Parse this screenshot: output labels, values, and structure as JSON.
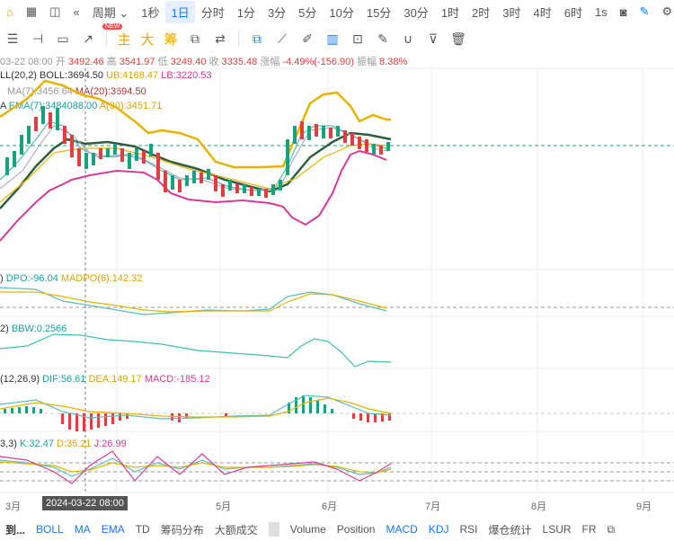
{
  "toolbar": {
    "period_label": "周期",
    "intervals": [
      "1秒",
      "1日",
      "分时",
      "1分",
      "3分",
      "5分",
      "10分",
      "15分",
      "30分",
      "1时",
      "2时",
      "3时",
      "4时",
      "6时"
    ],
    "active_interval": "1日",
    "right_interval": "1s",
    "new_badge": "NEW"
  },
  "toolbar2": {
    "main": "主",
    "big": "大",
    "chip": "筹"
  },
  "ohlc": {
    "date": "03-22 08:00",
    "open_label": "开",
    "open": "3492.46",
    "high_label": "高",
    "high": "3541.97",
    "low_label": "低",
    "low": "3249.40",
    "close_label": "收",
    "close": "3335.48",
    "change_label": "涨幅",
    "change": "-4.49%(-156.90)",
    "amp_label": "振幅",
    "amp": "8.38%"
  },
  "boll": {
    "name": "LL(20,2)",
    "boll": "BOLL:3694.50",
    "ub": "UB:4168.47",
    "lb": "LB:3220.53"
  },
  "ma": {
    "ma7": "MA(7):3456.64",
    "ma20": "MA(20):3694.50"
  },
  "ema": {
    "prefix": "A",
    "ema7": "EMA(7):3484088.00",
    "ema30": "A(30):3451.71"
  },
  "dpo": {
    "dpo": "DPO:-96.04",
    "madpo": "MADPO(6):142.32"
  },
  "bbw": {
    "prefix": "2)",
    "bbw": "BBW:0.2566"
  },
  "macd": {
    "name": "(12,26,9)",
    "dif": "DIF:56.61",
    "dea": "DEA:149.17",
    "macd": "MACD:-185.12"
  },
  "kdj": {
    "name": "3,3)",
    "k": "K:32.47",
    "d": "D:35.21",
    "j": "J:26.99"
  },
  "time_axis": {
    "labels": [
      "3月",
      "5月",
      "6月",
      "7月",
      "8月",
      "9月"
    ],
    "cursor": "2024-03-22 08:00"
  },
  "bottom": {
    "left": "到...",
    "items": [
      "BOLL",
      "MA",
      "EMA",
      "TD",
      "筹码分布",
      "大额成交",
      "Volume",
      "Position",
      "MACD",
      "KDJ",
      "RSI",
      "爆仓统计",
      "LSUR",
      "FR"
    ],
    "active": "MACD"
  }
}
